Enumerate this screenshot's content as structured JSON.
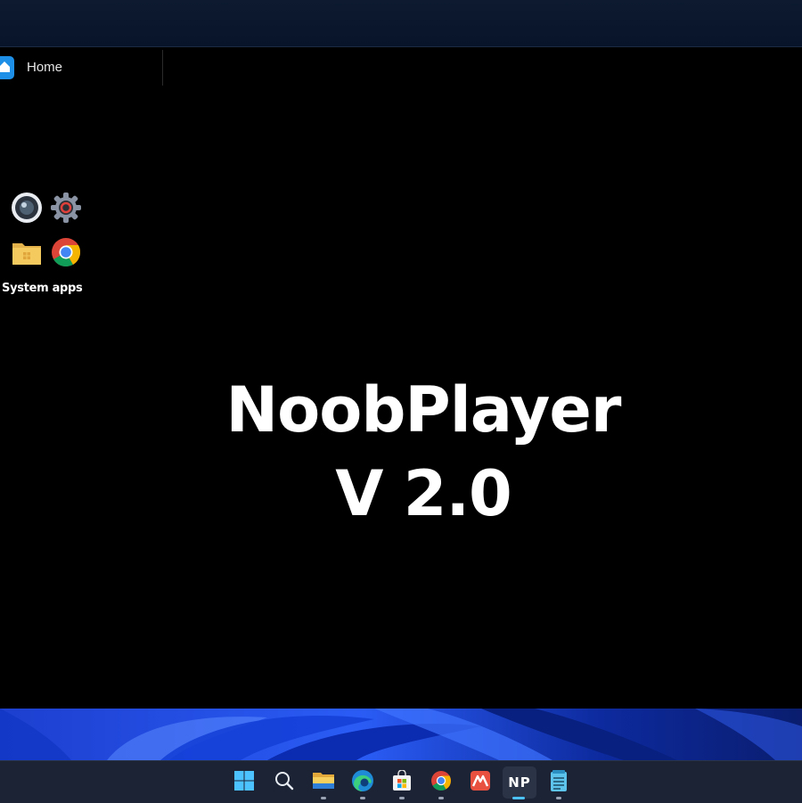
{
  "tab": {
    "label": "Home",
    "icon": "home-icon"
  },
  "desktop_group": {
    "label": "System apps",
    "apps": [
      {
        "name": "camera",
        "icon": "camera-icon"
      },
      {
        "name": "settings",
        "icon": "settings-gear-icon"
      },
      {
        "name": "file-explorer",
        "icon": "folder-icon"
      },
      {
        "name": "chrome",
        "icon": "chrome-icon"
      }
    ]
  },
  "splash": {
    "line1": "NoobPlayer",
    "line2": "V 2.0"
  },
  "taskbar": {
    "items": [
      {
        "name": "start",
        "icon": "windows-logo-icon"
      },
      {
        "name": "search",
        "icon": "search-icon"
      },
      {
        "name": "file-explorer",
        "icon": "folder-icon",
        "running": true
      },
      {
        "name": "edge",
        "icon": "edge-icon",
        "running": true
      },
      {
        "name": "store",
        "icon": "store-icon",
        "running": true
      },
      {
        "name": "chrome",
        "icon": "chrome-icon",
        "running": true
      },
      {
        "name": "app-red",
        "icon": "red-app-icon"
      },
      {
        "name": "noobplayer",
        "icon": "np-icon",
        "label": "NP",
        "active": true
      },
      {
        "name": "notepad",
        "icon": "notepad-icon",
        "running": true
      }
    ]
  },
  "colors": {
    "accent": "#4cc2ff",
    "taskbar_bg": "#1b2335",
    "window_bg": "#000000",
    "wallpaper_blue": "#1a4fe0"
  }
}
